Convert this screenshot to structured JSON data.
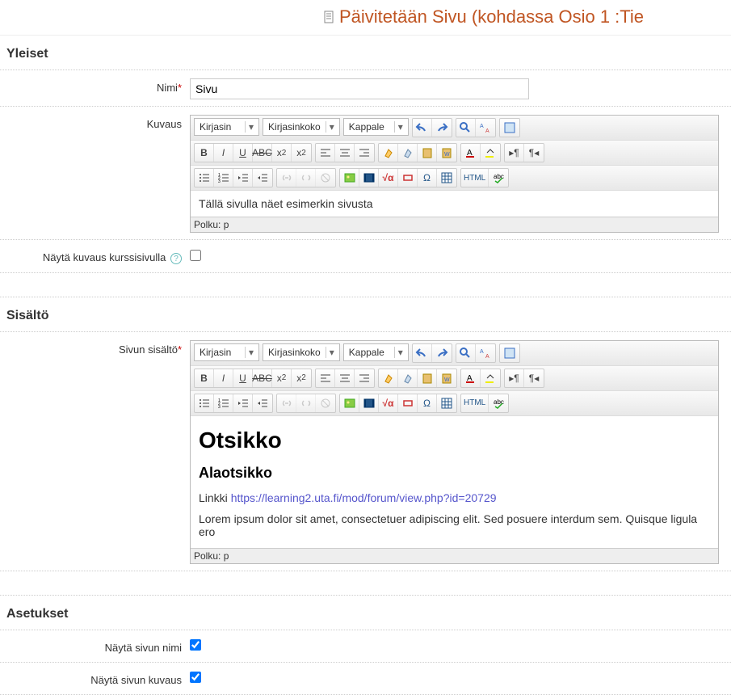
{
  "page_title": "Päivitetään Sivu (kohdassa Osio 1 :Tie",
  "sections": {
    "general": "Yleiset",
    "content": "Sisältö",
    "settings": "Asetukset"
  },
  "labels": {
    "name": "Nimi",
    "description": "Kuvaus",
    "show_desc_on_course": "Näytä kuvaus kurssisivulla",
    "page_content": "Sivun sisältö",
    "show_page_name": "Näytä sivun nimi",
    "show_page_desc": "Näytä sivun kuvaus"
  },
  "values": {
    "name": "Sivu",
    "description_text": "Tällä sivulla näet esimerkin sivusta",
    "content_h1": "Otsikko",
    "content_h2": "Alaotsikko",
    "content_link_label": "Linkki ",
    "content_link_url": "https://learning2.uta.fi/mod/forum/view.php?id=20729",
    "content_lorem": "Lorem ipsum dolor sit amet, consectetuer adipiscing elit. Sed posuere interdum sem. Quisque ligula ero",
    "show_desc_on_course": false,
    "show_page_name": true,
    "show_page_desc": true
  },
  "editor": {
    "font_select": "Kirjasin",
    "size_select": "Kirjasinkoko",
    "format_select": "Kappale",
    "status_prefix": "Polku: ",
    "status_path": "p",
    "html_label": "HTML"
  }
}
